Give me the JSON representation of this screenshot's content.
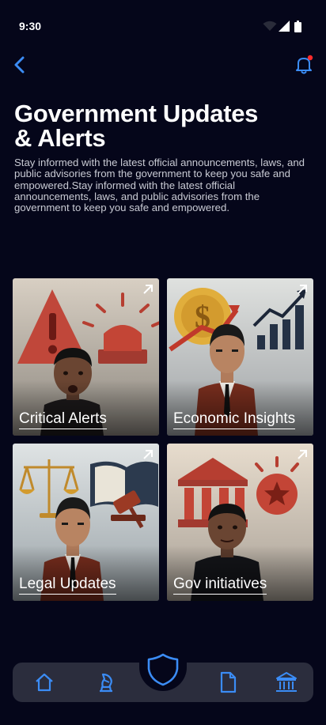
{
  "status_bar": {
    "time": "9:30",
    "icons": [
      "wifi-icon",
      "signal-icon",
      "battery-icon"
    ]
  },
  "header": {
    "back_icon": "chevron-left-icon",
    "notification_icon": "bell-icon",
    "notification_badge_color": "#ff2b2b"
  },
  "page": {
    "title_line1": "Government Updates",
    "title_line2": "& Alerts",
    "description": "Stay informed with the latest official announcements, laws, and public advisories from the government to keep you safe and empowered.Stay informed with the latest official announcements, laws, and public advisories from the government to keep you safe and empowered."
  },
  "tiles": [
    {
      "label": "Critical Alerts",
      "icon": "arrow-up-right-icon"
    },
    {
      "label": "Economic Insights",
      "icon": "arrow-up-right-icon"
    },
    {
      "label": "Legal Updates",
      "icon": "arrow-up-right-icon"
    },
    {
      "label": "Gov initiatives",
      "icon": "arrow-up-right-icon"
    }
  ],
  "bottom_nav": {
    "items": [
      "home-icon",
      "chess-knight-icon",
      "shield-icon",
      "document-icon",
      "government-building-icon"
    ],
    "accent_color": "#3b8cf5",
    "background_color": "#2b2d3d"
  },
  "colors": {
    "background": "#05061a",
    "accent": "#3b8cf5"
  }
}
